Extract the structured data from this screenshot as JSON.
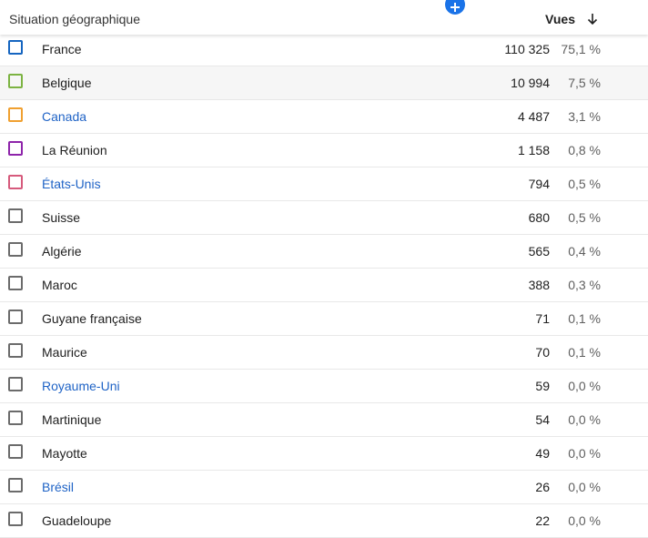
{
  "header": {
    "geo_label": "Situation géographique",
    "views_label": "Vues"
  },
  "icons": {
    "sort": "arrow-down-icon",
    "add_column": "plus-circle-icon"
  },
  "colors": {
    "france": "#1565c0",
    "belgique": "#7cb342",
    "canada": "#f0a030",
    "reunion": "#8e24aa",
    "etats_unis": "#d65a7c",
    "default": "#6b6b6b",
    "link": "#1f63c6",
    "accent": "#1a73e8"
  },
  "rows": [
    {
      "name": "France",
      "views": "110 325",
      "pct": "75,1 %"
    },
    {
      "name": "Belgique",
      "views": "10 994",
      "pct": "7,5 %"
    },
    {
      "name": "Canada",
      "views": "4 487",
      "pct": "3,1 %"
    },
    {
      "name": "La Réunion",
      "views": "1 158",
      "pct": "0,8 %"
    },
    {
      "name": "États-Unis",
      "views": "794",
      "pct": "0,5 %"
    },
    {
      "name": "Suisse",
      "views": "680",
      "pct": "0,5 %"
    },
    {
      "name": "Algérie",
      "views": "565",
      "pct": "0,4 %"
    },
    {
      "name": "Maroc",
      "views": "388",
      "pct": "0,3 %"
    },
    {
      "name": "Guyane française",
      "views": "71",
      "pct": "0,1 %"
    },
    {
      "name": "Maurice",
      "views": "70",
      "pct": "0,1 %"
    },
    {
      "name": "Royaume-Uni",
      "views": "59",
      "pct": "0,0 %"
    },
    {
      "name": "Martinique",
      "views": "54",
      "pct": "0,0 %"
    },
    {
      "name": "Mayotte",
      "views": "49",
      "pct": "0,0 %"
    },
    {
      "name": "Brésil",
      "views": "26",
      "pct": "0,0 %"
    },
    {
      "name": "Guadeloupe",
      "views": "22",
      "pct": "0,0 %"
    }
  ]
}
